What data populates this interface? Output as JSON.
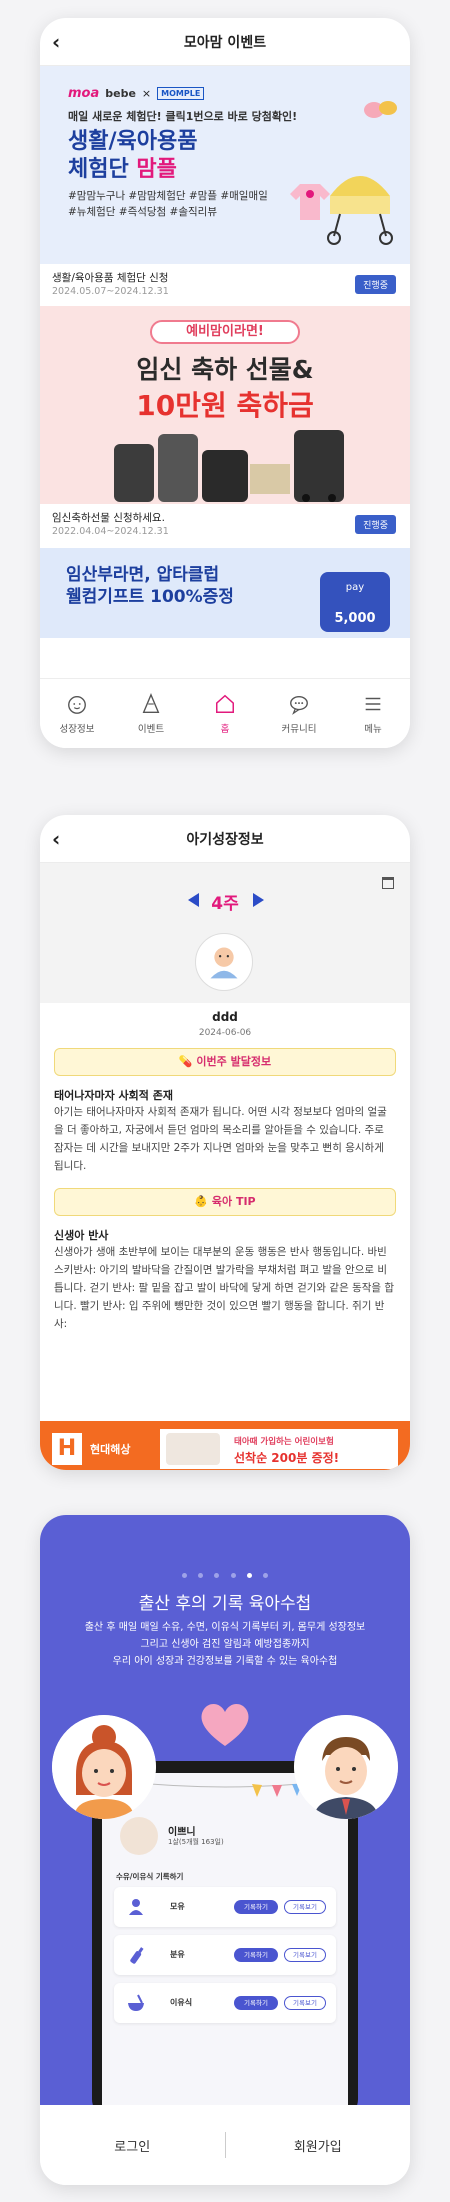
{
  "screen1": {
    "title": "모아맘 이벤트",
    "banner1": {
      "logo_moa": "moa",
      "logo_bebe": "bebe",
      "logo_momple": "MOMPLE",
      "subtitle": "매일 새로운 체험단! 클릭1번으로 바로 당첨확인!",
      "title_line1": "생활/육아용품",
      "title_line2": "체험단 ",
      "title_pink": "맘플",
      "tags_line1": "#맘맘누구나 #맘맘체험단 #맘플 #매일매일",
      "tags_line2": "#뉴체험단 #즉석당첨 #솔직리뷰"
    },
    "events": [
      {
        "title": "생활/육아용품 체험단 신청",
        "date": "2024.05.07~2024.12.31",
        "status": "진행중"
      },
      {
        "title": "임신축하선물 신청하세요.",
        "date": "2022.04.04~2024.12.31",
        "status": "진행중"
      }
    ],
    "banner2": {
      "pill": "예비맘이라면!",
      "line1": "임신 축하 선물&",
      "line2": "10만원 축하금"
    },
    "banner3": {
      "line1": "임산부라면, 압타클럽",
      "line2": "웰컴기프트 100%증정",
      "pay_label": "pay",
      "pay_amount": "5,000"
    },
    "tabs": [
      {
        "label": "성장정보",
        "icon": "baby-face-icon"
      },
      {
        "label": "이벤트",
        "icon": "party-hat-icon"
      },
      {
        "label": "홈",
        "icon": "home-icon"
      },
      {
        "label": "커뮤니티",
        "icon": "chat-bubble-icon"
      },
      {
        "label": "메뉴",
        "icon": "menu-icon"
      }
    ],
    "active_tab": "홈"
  },
  "screen2": {
    "title": "아기성장정보",
    "week": "4주",
    "baby_name": "ddd",
    "baby_date": "2024-06-06",
    "section1_label": "이번주 발달정보",
    "section1_title": "태어나자마자 사회적 존재",
    "section1_body": "아기는 태어나자마자 사회적 존재가 됩니다. 어떤 시각 정보보다 엄마의 얼굴을 더 좋아하고, 자궁에서 듣던 엄마의 목소리를 알아듣을 수 있습니다. 주로 잠자는 데 시간을 보내지만 2주가 지나면 엄마와 눈을 맞추고 뻔히 응시하게 됩니다.",
    "section2_label": "육아 TIP",
    "section2_title": "신생아 반사",
    "section2_body": "신생아가 생애 초반부에 보이는 대부분의 운동 행동은 반사 행동입니다. 바빈스키반사: 아기의 발바닥을 간질이면 발가락을 부채처럼 펴고 발을 안으로 비틉니다. 걷기 반사: 팔 밑을 잡고 발이 바닥에 닿게 하면 걷기와 같은 동작을 합니다. 빨기 반사: 입 주위에 뺑만한 것이 있으면 빨기 행동을 합니다. 쥐기 반사:",
    "ad": {
      "brand_letter": "H",
      "brand_name": "현대해상",
      "line1": "태아때 가입하는 어린이보험",
      "line2": "선착순 200분 증정!"
    }
  },
  "screen3": {
    "heading": "출산 후의 기록 육아수첩",
    "desc_line1": "출산 후 매일 매일 수유, 수면, 이유식 기록부터 키, 몸무게 성장정보",
    "desc_line2": "그리고 신생아 검진 알림과 예방접종까지",
    "desc_line3": "우리 아이 성장과 건강정보를 기록할 수 있는 육아수첩",
    "page_count": 6,
    "active_page": 5,
    "kid_name": "이쁘니",
    "kid_age": "1살(5개월 163일)",
    "log_title": "수유/이유식 기록하기",
    "logs": [
      {
        "label": "모유",
        "btn1": "기록하기",
        "btn2": "기록보기"
      },
      {
        "label": "분유",
        "btn1": "기록하기",
        "btn2": "기록보기"
      },
      {
        "label": "이유식",
        "btn1": "기록하기",
        "btn2": "기록보기"
      }
    ],
    "login": "로그인",
    "signup": "회원가입"
  },
  "colors": {
    "brand_pink": "#e2197c",
    "brand_blue": "#1d3f9e",
    "status_badge": "#3a5fc9",
    "onboarding_bg": "#5a5fd4",
    "ad_orange": "#f36b21"
  }
}
